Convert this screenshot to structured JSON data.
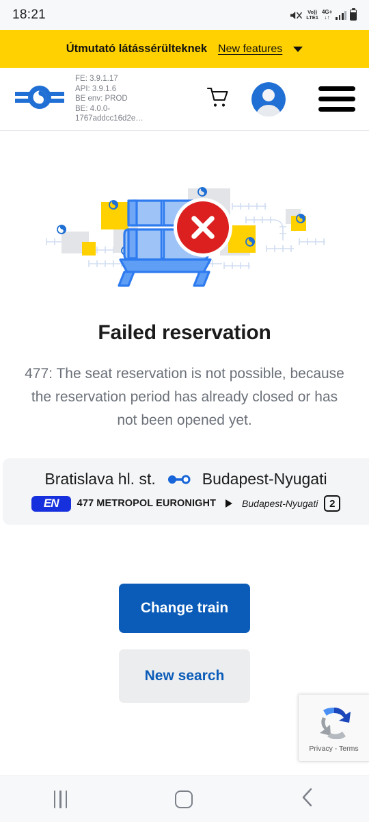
{
  "statusbar": {
    "time": "18:21",
    "mute_icon": "mute-icon",
    "volte_top": "Vo))",
    "volte_bottom": "LTE1",
    "network_top": "4G+",
    "network_bottom": "↓↑",
    "signal_icon": "signal-bars-icon",
    "battery_icon": "battery-icon"
  },
  "banner": {
    "title": "Útmutató látássérülteknek",
    "link": "New features",
    "chevron_icon": "chevron-down-icon"
  },
  "header": {
    "logo_icon": "mav-logo-icon",
    "versions": [
      "FE: 3.9.1.17",
      "API: 3.9.1.6",
      "BE env: PROD",
      "BE: 4.0.0-",
      "1767addcc16d2e…"
    ],
    "cart_icon": "shopping-cart-icon",
    "avatar_icon": "user-avatar-icon",
    "menu_icon": "hamburger-menu-icon"
  },
  "illustration": {
    "name": "failed-reservation-illustration",
    "badge_icon": "error-x-icon",
    "colors": {
      "seat_blue": "#4f90f0",
      "accent_yellow": "#ffd100",
      "error_red": "#dc2020",
      "track_gray": "#d8dade"
    }
  },
  "error": {
    "title": "Failed reservation",
    "description": "477: The seat reservation is not possible, because the reservation period has already closed or has not been opened yet."
  },
  "journey": {
    "origin": "Bratislava hl. st.",
    "destination": "Budapest-Nyugati",
    "connection_icon": "route-connection-icon",
    "train_logo_text": "EN",
    "train_name": "477 METROPOL EURONIGHT",
    "arrow_icon": "play-triangle-icon",
    "final_stop": "Budapest-Nyugati",
    "platform": "2"
  },
  "actions": {
    "primary_label": "Change train",
    "secondary_label": "New search"
  },
  "recaptcha": {
    "icon": "recaptcha-logo-icon",
    "label": "Privacy - Terms"
  },
  "navbar": {
    "recents_icon": "recents-icon",
    "home_icon": "home-icon",
    "back_icon": "back-icon"
  },
  "theme": {
    "banner_yellow": "#ffd100",
    "primary_blue": "#0b5cb8",
    "panel_gray": "#f4f5f7",
    "text_dark": "#1b1b1b",
    "text_muted": "#6b7079"
  }
}
